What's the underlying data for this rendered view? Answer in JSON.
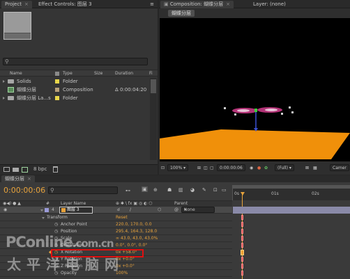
{
  "project": {
    "tabs": {
      "project": "Project",
      "effect_controls": "Effect Controls: 图层 3"
    },
    "columns": {
      "name": "Name",
      "type": "Type",
      "size": "Size",
      "duration": "Duration",
      "extra": "Fi"
    },
    "items": [
      {
        "name": "Solids",
        "type": "Folder",
        "duration": "",
        "color": "#e8d64a",
        "kind": "folder"
      },
      {
        "name": "蝴蝶分层",
        "type": "Composition",
        "duration": "Δ 0:00:04:20",
        "color": "#b8a07a",
        "kind": "comp"
      },
      {
        "name": "蝴蝶分层 La...s",
        "type": "Folder",
        "duration": "",
        "color": "#e8d64a",
        "kind": "folder"
      }
    ],
    "bpc": "8 bpc"
  },
  "composition": {
    "tab": "Composition: 蝴蝶分层",
    "layer_tab": "Layer: (none)",
    "subtab": "蝴蝶分层",
    "zoom": "100%",
    "timecode": "0:00:00:06",
    "resolution": "(Full)",
    "camera": "Camer",
    "colors": {
      "floor": "#f0900a",
      "wing": "#d23c8c",
      "bg": "#000000"
    }
  },
  "timeline": {
    "tab": "蝴蝶分层",
    "timecode": "0:00:00:06",
    "ruler": [
      "0s",
      "01s",
      "02s"
    ],
    "headers": {
      "layer_name": "Layer Name",
      "parent": "Parent"
    },
    "layer": {
      "num": "4",
      "name": "图层 3",
      "parent": "None"
    },
    "transform": {
      "label": "Transform",
      "reset": "Reset"
    },
    "properties": [
      {
        "name": "Anchor Point",
        "value": "220.0, 170.0, 0.0"
      },
      {
        "name": "Position",
        "value": "295.4, 164.3, 128.0"
      },
      {
        "name": "Scale",
        "value": "∞ 43.0, 43.0, 43.0%"
      },
      {
        "name": "Orientation",
        "value": "0.0°, 0.0°, 0.0°"
      },
      {
        "name": "X Rotation",
        "value": "0x +58.0°"
      },
      {
        "name": "Y Rotation",
        "value": "0x +0.0°"
      },
      {
        "name": "Z Rotation",
        "value": "0x +0.0°"
      },
      {
        "name": "Opacity",
        "value": "100%"
      }
    ],
    "highlight_color": "#e01010"
  },
  "watermark": {
    "line1": "PConline",
    "domain": ".com.cn",
    "line2": "太平洋电脑网"
  }
}
